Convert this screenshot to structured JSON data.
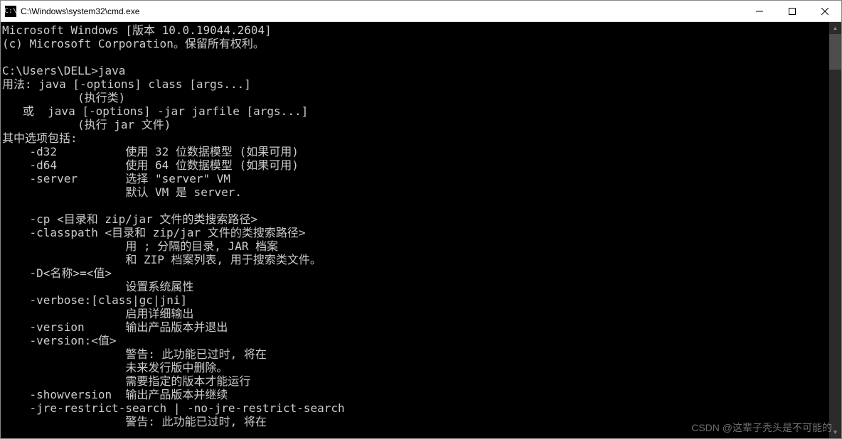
{
  "titlebar": {
    "icon_label": "C:\\",
    "title": "C:\\Windows\\system32\\cmd.exe"
  },
  "terminal": {
    "lines": [
      "Microsoft Windows [版本 10.0.19044.2604]",
      "(c) Microsoft Corporation。保留所有权利。",
      "",
      "C:\\Users\\DELL>java",
      "用法: java [-options] class [args...]",
      "           (执行类)",
      "   或  java [-options] -jar jarfile [args...]",
      "           (执行 jar 文件)",
      "其中选项包括:",
      "    -d32          使用 32 位数据模型 (如果可用)",
      "    -d64          使用 64 位数据模型 (如果可用)",
      "    -server       选择 \"server\" VM",
      "                  默认 VM 是 server.",
      "",
      "    -cp <目录和 zip/jar 文件的类搜索路径>",
      "    -classpath <目录和 zip/jar 文件的类搜索路径>",
      "                  用 ; 分隔的目录, JAR 档案",
      "                  和 ZIP 档案列表, 用于搜索类文件。",
      "    -D<名称>=<值>",
      "                  设置系统属性",
      "    -verbose:[class|gc|jni]",
      "                  启用详细输出",
      "    -version      输出产品版本并退出",
      "    -version:<值>",
      "                  警告: 此功能已过时, 将在",
      "                  未来发行版中删除。",
      "                  需要指定的版本才能运行",
      "    -showversion  输出产品版本并继续",
      "    -jre-restrict-search | -no-jre-restrict-search",
      "                  警告: 此功能已过时, 将在"
    ]
  },
  "watermark": "CSDN @这辈子秃头是不可能的"
}
